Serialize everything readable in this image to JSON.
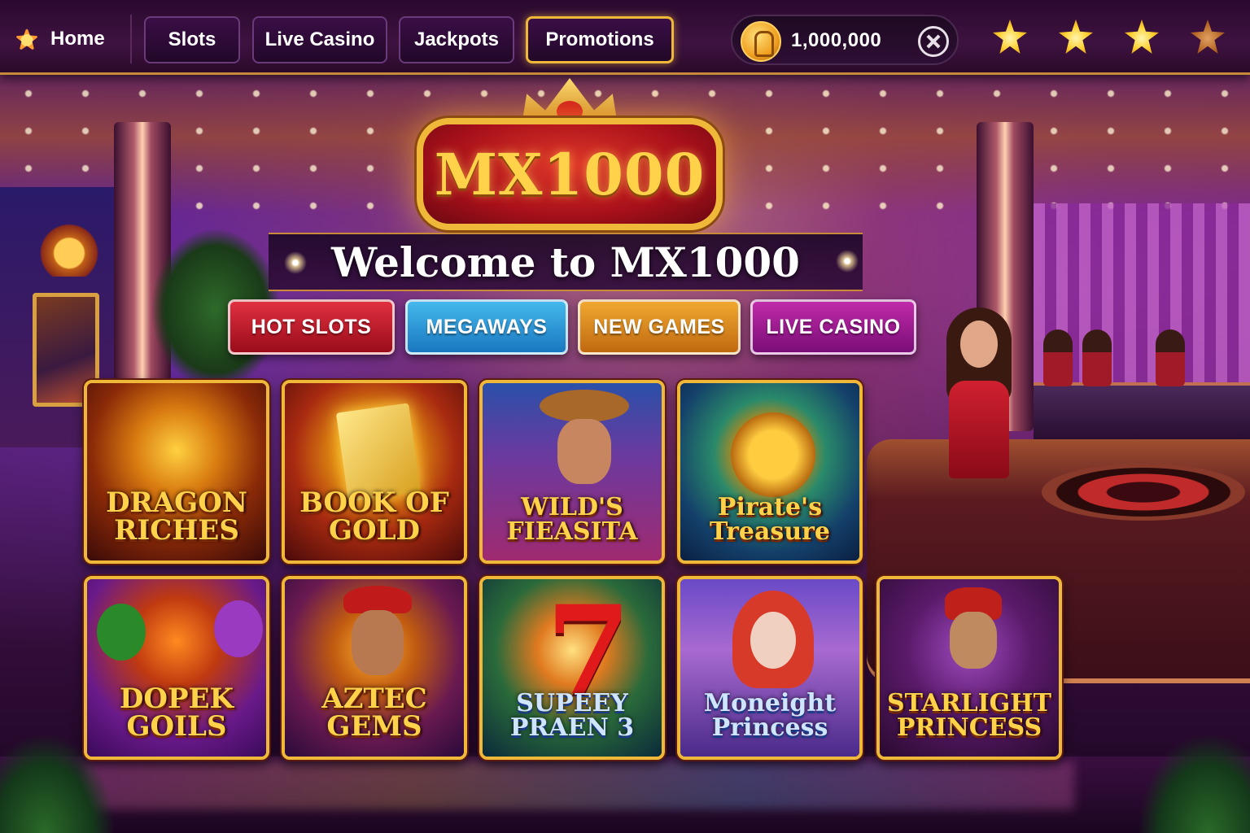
{
  "nav": {
    "home_label": "Home",
    "items": [
      {
        "label": "Slots",
        "active": false
      },
      {
        "label": "Live Casino",
        "active": false
      },
      {
        "label": "Jackpots",
        "active": false
      },
      {
        "label": "Promotions",
        "active": true
      }
    ],
    "balance": "1,000,000",
    "icons": [
      "home-star-icon",
      "coin-avatar-icon",
      "wallet-icon",
      "star-icon",
      "star-icon",
      "star-icon",
      "star-icon"
    ],
    "stars_filled": 3,
    "stars_total": 4
  },
  "hero": {
    "logo_text": "MX1000",
    "welcome": "Welcome to MX1000"
  },
  "categories": [
    {
      "label": "HOT SLOTS",
      "color": "#c01a2a"
    },
    {
      "label": "MEGAWAYS",
      "color": "#2a98d8"
    },
    {
      "label": "NEW GAMES",
      "color": "#e08a20"
    },
    {
      "label": "LIVE CASINO",
      "color": "#a01a98"
    }
  ],
  "games": [
    {
      "title": "DRAGON\nRICHES"
    },
    {
      "title": "BOOK OF\nGOLD"
    },
    {
      "title": "WILD'S\nFIEASITA"
    },
    {
      "title": "Pirate's\nTreasure"
    },
    {
      "title": "DOPEK\nGOILS"
    },
    {
      "title": "AZTEC\nGEMS"
    },
    {
      "title": "SUPEEY\nPRAEN 3"
    },
    {
      "title": "Moneight\nPrincess"
    },
    {
      "title": "STARLIGHT\nPRINCESS"
    }
  ],
  "colors": {
    "accent_gold": "#f0b838",
    "nav_bg": "#2a0a2e",
    "logo_red": "#a8101a"
  }
}
